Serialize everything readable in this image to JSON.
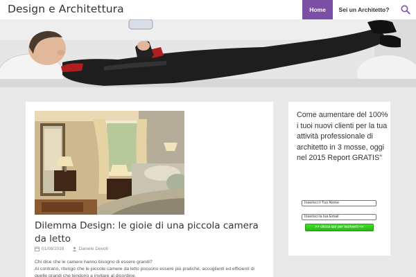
{
  "site": {
    "title": "Design e Architettura"
  },
  "nav": {
    "items": [
      {
        "label": "Home",
        "active": true
      },
      {
        "label": "Sei un Architetto?",
        "active": false
      }
    ],
    "search_icon": "search-icon",
    "accent_color": "#7b4fa6"
  },
  "post": {
    "title": "Dilemma Design: le gioie di una piccola camera da letto",
    "date": "01/08/2016",
    "author": "Daniele Devoti",
    "excerpt_line1": "Chi dice che le camere hanno bisogno di essere grandi?",
    "excerpt_line2": "Al contrario, ritengo che le piccole camere da letto possono essere più pratiche, accoglienti ed efficienti di quelle grandi che tendono a invitare al disordine."
  },
  "widget": {
    "text": "Come aumentare del 100% i tuoi nuovi clienti per la tua attività professionale di architetto in 3 mosse, oggi nel 2015 Report GRATIS\"",
    "name_placeholder": "Inserisci il Tuo Nome",
    "email_placeholder": "Inserisci la tua Email",
    "button_label": ">> clicca qui per iscriverti <<",
    "button_color": "#2fc41a"
  }
}
